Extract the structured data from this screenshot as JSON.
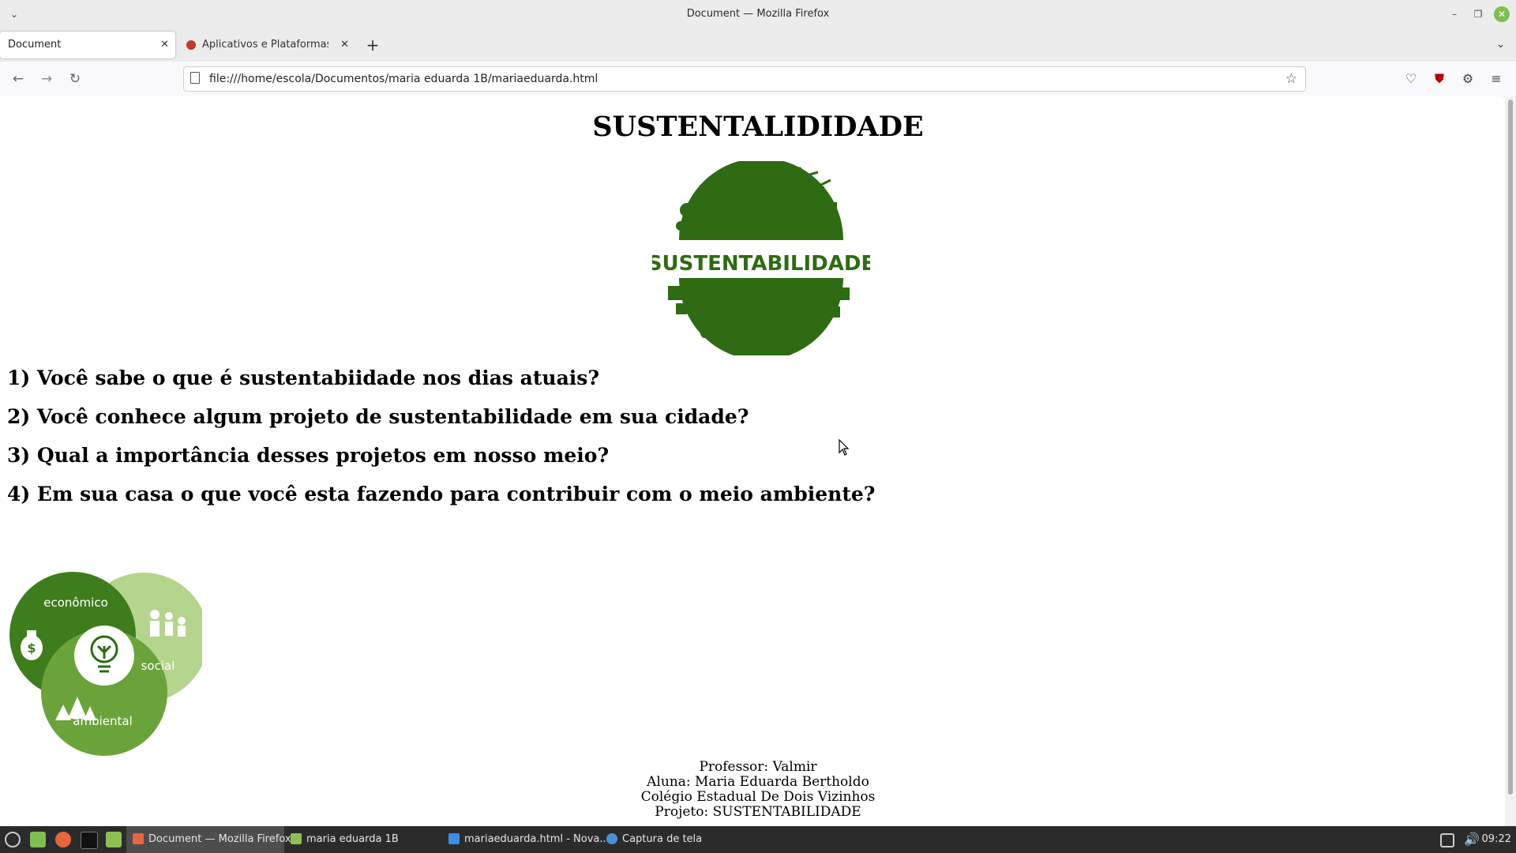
{
  "window": {
    "title": "Document — Mozilla Firefox",
    "minimize_glyph": "–",
    "restore_glyph": "❐",
    "close_glyph": "✕"
  },
  "tabs": [
    {
      "label": "Document",
      "active": true,
      "close": "✕"
    },
    {
      "label": "Aplicativos e Plataformas E",
      "active": false,
      "close": "✕"
    }
  ],
  "new_tab_glyph": "+",
  "tab_list_glyph": "⌄",
  "navbar": {
    "url": "file:///home/escola/Documentos/maria eduarda 1B/mariaeduarda.html",
    "back_glyph": "←",
    "forward_glyph": "→",
    "reload_glyph": "↻",
    "star_glyph": "☆"
  },
  "page": {
    "title": "SUSTENTALIDIDADE",
    "logo_text": "SUSTENTABILIDADE",
    "questions": [
      "1) Você sabe o que é sustentabiidade nos dias atuais?",
      "2) Você conhece algum projeto de sustentabilidade em sua cidade?",
      "3) Qual a importância desses projetos em nosso meio?",
      "4) Em sua casa o que você esta fazendo para contribuir com o meio ambiente?"
    ],
    "venn_labels": {
      "economico": "econômico",
      "social": "social",
      "ambiental": "ambiental"
    },
    "footer": [
      "Professor: Valmir",
      "Aluna: Maria Eduarda Bertholdo",
      "Colégio Estadual De Dois Vizinhos",
      "Projeto: SUSTENTABILIDADE"
    ]
  },
  "taskbar": {
    "items": [
      {
        "label": "Document — Mozilla Firefox",
        "active": true
      },
      {
        "label": "maria eduarda 1B",
        "active": false
      },
      {
        "label": "mariaeduarda.html - Nova...",
        "active": false
      },
      {
        "label": "Captura de tela",
        "active": false
      }
    ],
    "clock": "09:22"
  },
  "colors": {
    "green_dark": "#2e6b12",
    "green_mid": "#6aa33a",
    "green_light": "#b5d48d"
  }
}
